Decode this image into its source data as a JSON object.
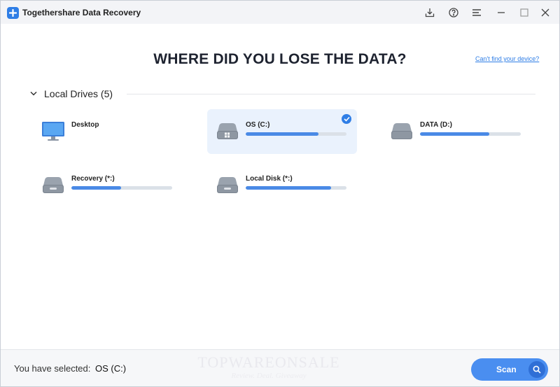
{
  "window": {
    "title": "Togethershare Data Recovery",
    "controls": [
      "download-icon",
      "help-icon",
      "menu-icon",
      "minimize-icon",
      "maximize-icon",
      "close-icon"
    ]
  },
  "main": {
    "headline": "WHERE DID YOU LOSE THE DATA?",
    "cant_find_link": "Can't find your device?",
    "section": {
      "label": "Local Drives (5)",
      "icon": "chevron-down-icon"
    },
    "drives": [
      {
        "name": "Desktop",
        "icon": "monitor-icon",
        "has_bar": false,
        "selected": false
      },
      {
        "name": "OS (C:)",
        "icon": "windows-drive-icon",
        "has_bar": true,
        "usage": 0.72,
        "selected": true
      },
      {
        "name": "DATA (D:)",
        "icon": "hard-drive-icon",
        "has_bar": true,
        "usage": 0.69,
        "selected": false
      },
      {
        "name": "Recovery (*:)",
        "icon": "hard-drive-icon",
        "has_bar": true,
        "usage": 0.49,
        "selected": false
      },
      {
        "name": "Local Disk (*:)",
        "icon": "hard-drive-icon",
        "has_bar": true,
        "usage": 0.85,
        "selected": false
      }
    ]
  },
  "footer": {
    "selected_label": "You have selected:",
    "selected_value": "OS (C:)",
    "scan_label": "Scan",
    "watermark": "TOPWAREONSALE",
    "watermark_sub": "Review. Deal. Giveaway"
  },
  "colors": {
    "accent": "#2f7ee6",
    "bar_fill": "#4a8ae6",
    "selected_bg": "#eaf2fd"
  }
}
